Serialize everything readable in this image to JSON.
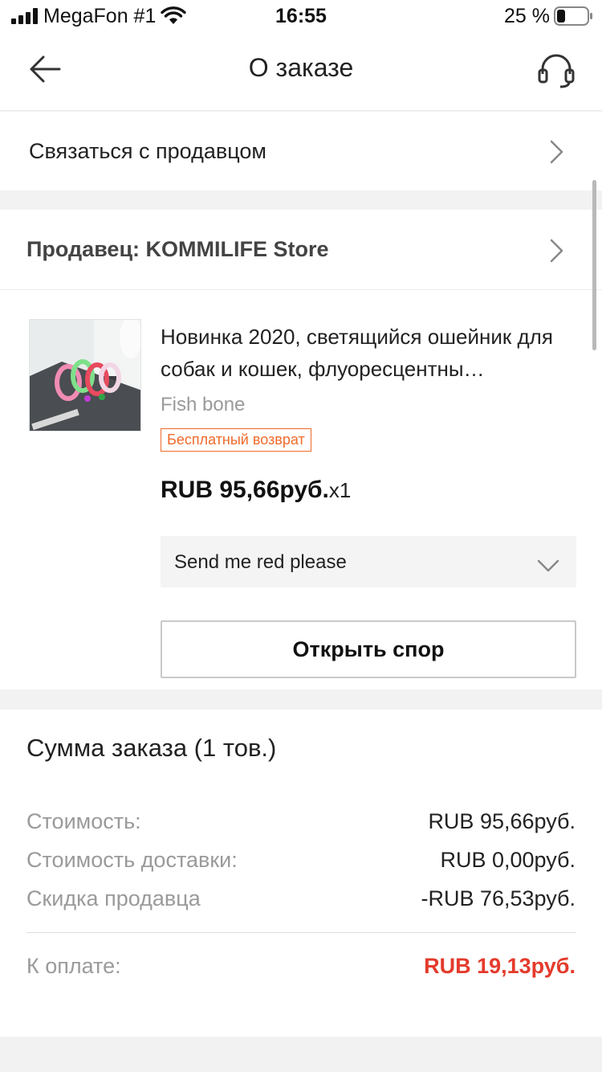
{
  "status_bar": {
    "carrier": "MegaFon #1",
    "time": "16:55",
    "battery_percent": "25 %"
  },
  "nav": {
    "title": "О заказе"
  },
  "contact_seller": {
    "label": "Связаться с продавцом"
  },
  "seller": {
    "name": "Продавец: KOMMILIFE Store"
  },
  "product": {
    "title": "Новинка 2020, светящийся ошейник для собак и кошек, флуоресцентны…",
    "sku": "Fish bone",
    "badge": "Бесплатный возврат",
    "price": "RUB 95,66руб.",
    "quantity": "x1",
    "note": "Send me red please",
    "dispute_button": "Открыть спор"
  },
  "summary": {
    "title": "Сумма заказа (1 тов.)",
    "rows": [
      {
        "label": "Стоимость:",
        "value": "RUB 95,66руб."
      },
      {
        "label": "Стоимость доставки:",
        "value": "RUB 0,00руб."
      },
      {
        "label": "Скидка продавца",
        "value": "-RUB 76,53руб."
      }
    ],
    "total_label": "К оплате:",
    "total_value": "RUB 19,13руб."
  },
  "colors": {
    "accent_red": "#e43b2c",
    "badge_orange": "#f06a2a"
  }
}
